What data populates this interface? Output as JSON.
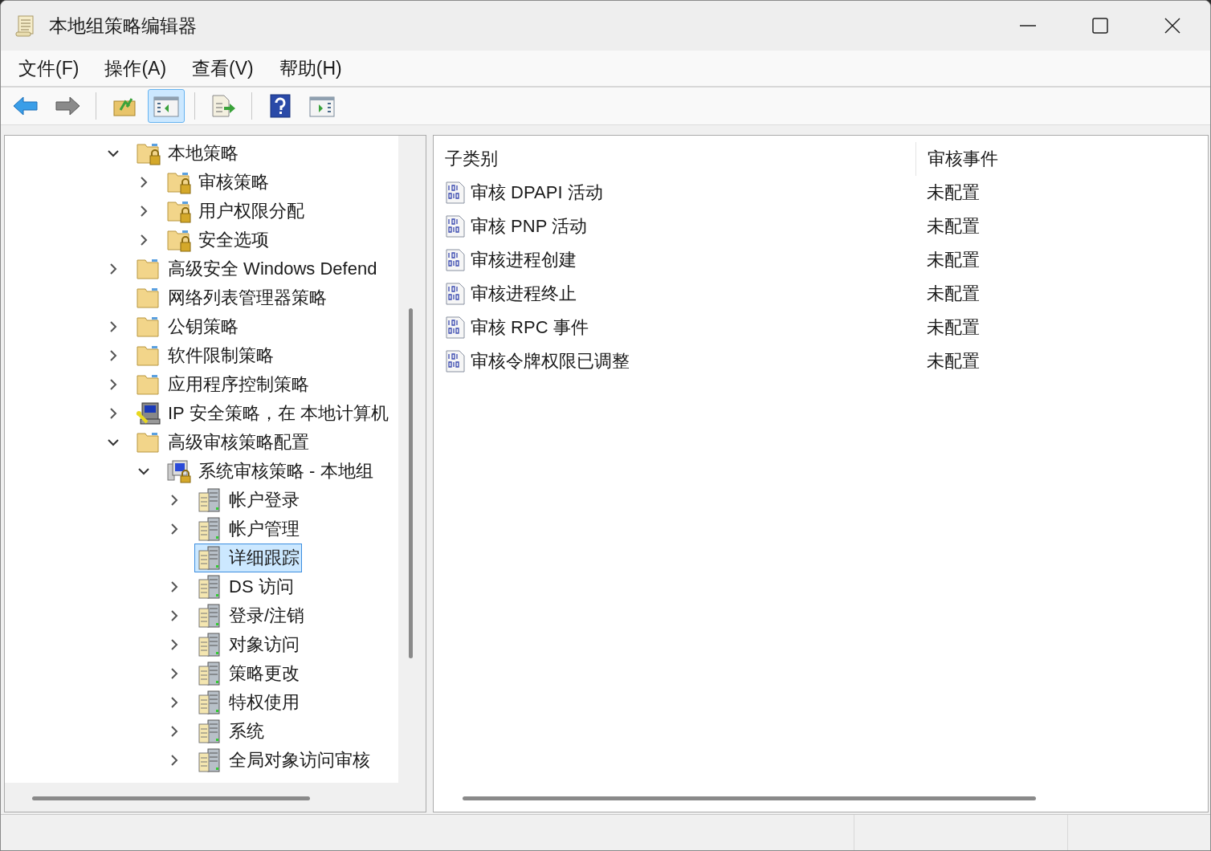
{
  "window": {
    "title": "本地组策略编辑器"
  },
  "menu": [
    "文件(F)",
    "操作(A)",
    "查看(V)",
    "帮助(H)"
  ],
  "toolbar": [
    {
      "kind": "back",
      "pressed": false
    },
    {
      "kind": "forward",
      "pressed": false
    },
    {
      "kind": "sep"
    },
    {
      "kind": "up",
      "pressed": false
    },
    {
      "kind": "tree",
      "pressed": true
    },
    {
      "kind": "sep"
    },
    {
      "kind": "export",
      "pressed": false
    },
    {
      "kind": "sep"
    },
    {
      "kind": "help",
      "pressed": false
    },
    {
      "kind": "pane",
      "pressed": false
    }
  ],
  "tree": [
    {
      "label": "本地策略",
      "kind": "locked-folder",
      "expanded": true,
      "selected": false,
      "children": [
        {
          "label": "审核策略",
          "kind": "locked-folder",
          "expanded": false,
          "selected": false
        },
        {
          "label": "用户权限分配",
          "kind": "locked-folder",
          "expanded": false,
          "selected": false
        },
        {
          "label": "安全选项",
          "kind": "locked-folder",
          "expanded": false,
          "selected": false
        }
      ]
    },
    {
      "label": "高级安全 Windows Defend",
      "kind": "folder",
      "expanded": false,
      "selected": false
    },
    {
      "label": "网络列表管理器策略",
      "kind": "folder",
      "selected": false
    },
    {
      "label": "公钥策略",
      "kind": "folder",
      "expanded": false,
      "selected": false
    },
    {
      "label": "软件限制策略",
      "kind": "folder",
      "expanded": false,
      "selected": false
    },
    {
      "label": "应用程序控制策略",
      "kind": "folder",
      "expanded": false,
      "selected": false
    },
    {
      "label": "IP 安全策略，在 本地计算机",
      "kind": "ipsec",
      "expanded": false,
      "selected": false
    },
    {
      "label": "高级审核策略配置",
      "kind": "folder",
      "expanded": true,
      "selected": false,
      "children": [
        {
          "label": "系统审核策略 - 本地组",
          "kind": "audit-root",
          "expanded": true,
          "selected": false,
          "children": [
            {
              "label": "帐户登录",
              "kind": "category",
              "expanded": false,
              "selected": false
            },
            {
              "label": "帐户管理",
              "kind": "category",
              "expanded": false,
              "selected": false
            },
            {
              "label": "详细跟踪",
              "kind": "category",
              "selected": true
            },
            {
              "label": "DS 访问",
              "kind": "category",
              "expanded": false,
              "selected": false
            },
            {
              "label": "登录/注销",
              "kind": "category",
              "expanded": false,
              "selected": false
            },
            {
              "label": "对象访问",
              "kind": "category",
              "expanded": false,
              "selected": false
            },
            {
              "label": "策略更改",
              "kind": "category",
              "expanded": false,
              "selected": false
            },
            {
              "label": "特权使用",
              "kind": "category",
              "expanded": false,
              "selected": false
            },
            {
              "label": "系统",
              "kind": "category",
              "expanded": false,
              "selected": false
            },
            {
              "label": "全局对象访问审核",
              "kind": "category",
              "expanded": false,
              "selected": false
            }
          ]
        }
      ]
    }
  ],
  "list": {
    "columns": [
      "子类别",
      "审核事件"
    ],
    "rows": [
      {
        "name": "审核 DPAPI 活动",
        "value": "未配置"
      },
      {
        "name": "审核 PNP 活动",
        "value": "未配置"
      },
      {
        "name": "审核进程创建",
        "value": "未配置"
      },
      {
        "name": "审核进程终止",
        "value": "未配置"
      },
      {
        "name": "审核 RPC 事件",
        "value": "未配置"
      },
      {
        "name": "审核令牌权限已调整",
        "value": "未配置"
      }
    ]
  }
}
